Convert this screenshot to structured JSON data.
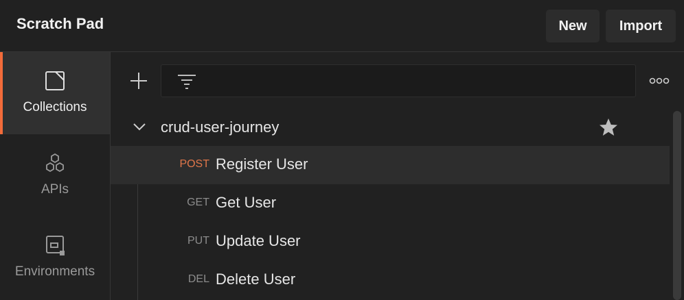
{
  "header": {
    "title": "Scratch Pad",
    "new_label": "New",
    "import_label": "Import"
  },
  "sidebar": {
    "items": [
      {
        "label": "Collections",
        "icon": "collections-icon",
        "active": true
      },
      {
        "label": "APIs",
        "icon": "apis-icon",
        "active": false
      },
      {
        "label": "Environments",
        "icon": "environments-icon",
        "active": false
      }
    ]
  },
  "toolbar": {
    "add_icon": "plus-icon",
    "filter_icon": "filter-icon",
    "filter_value": "",
    "more_icon": "more-icon"
  },
  "collection": {
    "name": "crud-user-journey",
    "expanded": true,
    "starred": true
  },
  "requests": [
    {
      "method": "POST",
      "name": "Register User",
      "selected": true
    },
    {
      "method": "GET",
      "name": "Get User",
      "selected": false
    },
    {
      "method": "PUT",
      "name": "Update User",
      "selected": false
    },
    {
      "method": "DEL",
      "name": "Delete User",
      "selected": false
    }
  ],
  "colors": {
    "accent": "#f26b3a",
    "post_method": "#e0764a",
    "background": "#212121"
  }
}
